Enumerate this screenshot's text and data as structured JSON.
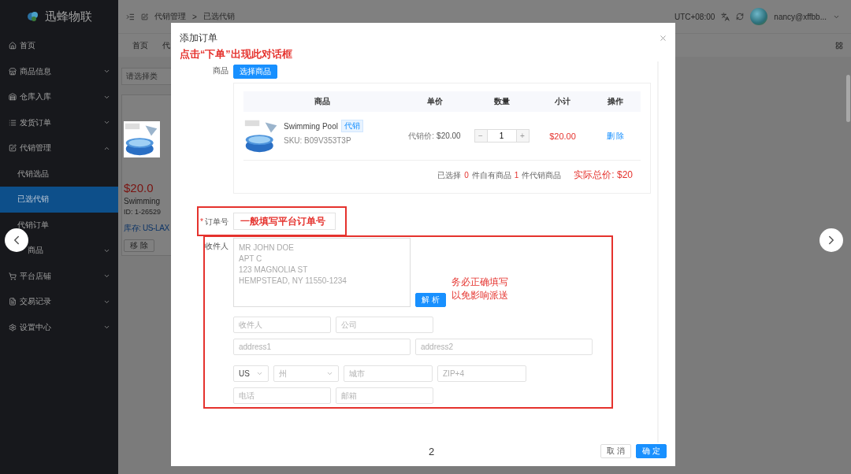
{
  "sidebar": {
    "brand": "迅蜂物联",
    "items": [
      {
        "label": "首页",
        "selected": false
      },
      {
        "label": "商品信息",
        "expanded": false,
        "selected": false
      },
      {
        "label": "仓库入库",
        "expanded": false,
        "selected": false
      },
      {
        "label": "发货订单",
        "expanded": false,
        "selected": false
      },
      {
        "label": "代销管理",
        "expanded": true,
        "selected": false,
        "children": [
          {
            "label": "代销选品",
            "selected": false
          },
          {
            "label": "已选代销",
            "selected": true
          },
          {
            "label": "代销订单",
            "selected": false
          }
        ]
      },
      {
        "label": "商品",
        "expanded": false,
        "selected": false
      },
      {
        "label": "平台店铺",
        "expanded": false,
        "selected": false
      },
      {
        "label": "交易记录",
        "expanded": false,
        "selected": false
      },
      {
        "label": "设置中心",
        "expanded": false,
        "selected": false
      }
    ]
  },
  "header": {
    "breadcrumb": [
      "代销管理",
      "已选代销"
    ],
    "separator": ">",
    "timezone": "UTC+08:00",
    "user": "nancy@xffbb..."
  },
  "tabs": [
    {
      "label": "首页",
      "selected": false
    },
    {
      "label": "代",
      "selected": false
    }
  ],
  "background": {
    "category_placeholder": "请选择类",
    "card": {
      "price": "$20.0",
      "name": "Swimming",
      "id": "ID: 1-26529",
      "stock": "库存: US-LAX",
      "button": "移 除"
    }
  },
  "dialog": {
    "title": "添加订单",
    "note": "点击“下单”出现此对话框",
    "product_label": "商品",
    "choose_button": "选择商品",
    "table": {
      "columns": [
        "商品",
        "单价",
        "数量",
        "小计",
        "操作"
      ],
      "rows": [
        {
          "name": "Swimming Pool",
          "tag": "代销",
          "sku": "SKU: B09V353T3P",
          "price_label": "代销价:",
          "price": "$20.00",
          "quantity": "1",
          "minus": "−",
          "plus": "+",
          "subtotal": "$20.00",
          "action": "删 除"
        }
      ],
      "summary": {
        "prefix": "已选择",
        "own_count": "0",
        "own_label": "件自有商品",
        "consign_count": "1",
        "consign_label": "件代销商品",
        "total": "实际总价: $20"
      }
    },
    "order_no": {
      "label": "订单号",
      "required_mark": "*",
      "note": "一般填写平台订单号"
    },
    "recipient": {
      "label": "收件人",
      "placeholder": "MR JOHN DOE\nAPT C\n123 MAGNOLIA ST\nHEMPSTEAD, NY 11550-1234",
      "parse_button": "解 析",
      "note": [
        "务必正确填写",
        "以免影响派送"
      ],
      "fields": [
        [
          {
            "kind": "input",
            "placeholder": "收件人"
          },
          {
            "kind": "input",
            "placeholder": "公司"
          }
        ],
        [
          {
            "kind": "input",
            "placeholder": "address1"
          },
          {
            "kind": "input",
            "placeholder": "address2"
          }
        ],
        [
          {
            "kind": "select",
            "value": "US"
          },
          {
            "kind": "select",
            "placeholder": "州"
          },
          {
            "kind": "input",
            "placeholder": "城市"
          },
          {
            "kind": "input",
            "placeholder": "ZIP+4"
          }
        ],
        [
          {
            "kind": "input",
            "placeholder": "电话"
          },
          {
            "kind": "input",
            "placeholder": "邮箱"
          }
        ]
      ]
    },
    "page_number": "2",
    "buttons": [
      {
        "label": "取 消",
        "primary": false
      },
      {
        "label": "确 定",
        "primary": true
      }
    ]
  }
}
